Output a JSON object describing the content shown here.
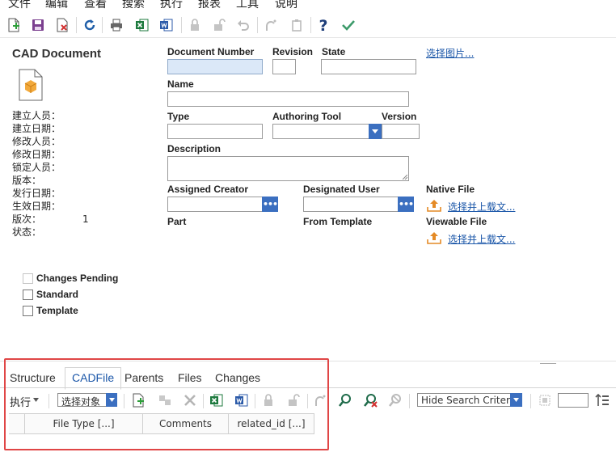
{
  "menu": [
    "文件",
    "编辑",
    "查看",
    "搜索",
    "执行",
    "报表",
    "工具",
    "说明"
  ],
  "toolbar_icons": [
    "new-icon",
    "save-icon",
    "delete-icon",
    "refresh-icon",
    "print-icon",
    "excel-icon",
    "word-icon",
    "lock-icon",
    "unlock-icon",
    "undo-icon",
    "promote-icon",
    "clipboard-icon",
    "help-icon",
    "done-icon"
  ],
  "left_panel": {
    "title": "CAD Document",
    "meta_labels": [
      "建立人员：",
      "建立日期：",
      "修改人员：",
      "修改日期：",
      "锁定人员：",
      "版本：",
      "发行日期：",
      "生效日期：",
      "版次：",
      "状态："
    ],
    "generation_value": "1"
  },
  "form": {
    "document_number_label": "Document Number",
    "document_number_value": "",
    "revision_label": "Revision",
    "revision_value": "",
    "state_label": "State",
    "state_value": "",
    "select_image_link": "选择图片...",
    "name_label": "Name",
    "name_value": "",
    "type_label": "Type",
    "type_value": "",
    "authoring_tool_label": "Authoring Tool",
    "authoring_tool_value": "",
    "version_label": "Version",
    "version_value": "",
    "description_label": "Description",
    "description_value": "",
    "assigned_creator_label": "Assigned Creator",
    "assigned_creator_value": "",
    "designated_user_label": "Designated User",
    "designated_user_value": "",
    "native_file_label": "Native File",
    "native_file_link": "选择并上载文...",
    "viewable_file_label": "Viewable File",
    "viewable_file_link": "选择并上载文...",
    "part_label": "Part",
    "from_template_label": "From Template",
    "lookup_button": "•••"
  },
  "checkboxes": [
    {
      "label": "Changes Pending",
      "checked": false,
      "disabled": true
    },
    {
      "label": "Standard",
      "checked": false,
      "disabled": false
    },
    {
      "label": "Template",
      "checked": false,
      "disabled": false
    }
  ],
  "tabs": [
    {
      "label": "Structure",
      "active": false
    },
    {
      "label": "CADFile",
      "active": true
    },
    {
      "label": "Parents",
      "active": false
    },
    {
      "label": "Files",
      "active": false
    },
    {
      "label": "Changes",
      "active": false
    }
  ],
  "relationship_toolbar": {
    "actions_label": "执行",
    "select_object": "选择对象",
    "search_mode": "Hide Search Criteria",
    "page_input": ""
  },
  "grid_columns": [
    "",
    "File Type [...]",
    "Comments",
    "related_id [...]"
  ],
  "colors": {
    "accent": "#3b6fc0",
    "required_field": "#dbe8f8",
    "link": "#1a56a8",
    "highlight_frame": "#e04646"
  }
}
